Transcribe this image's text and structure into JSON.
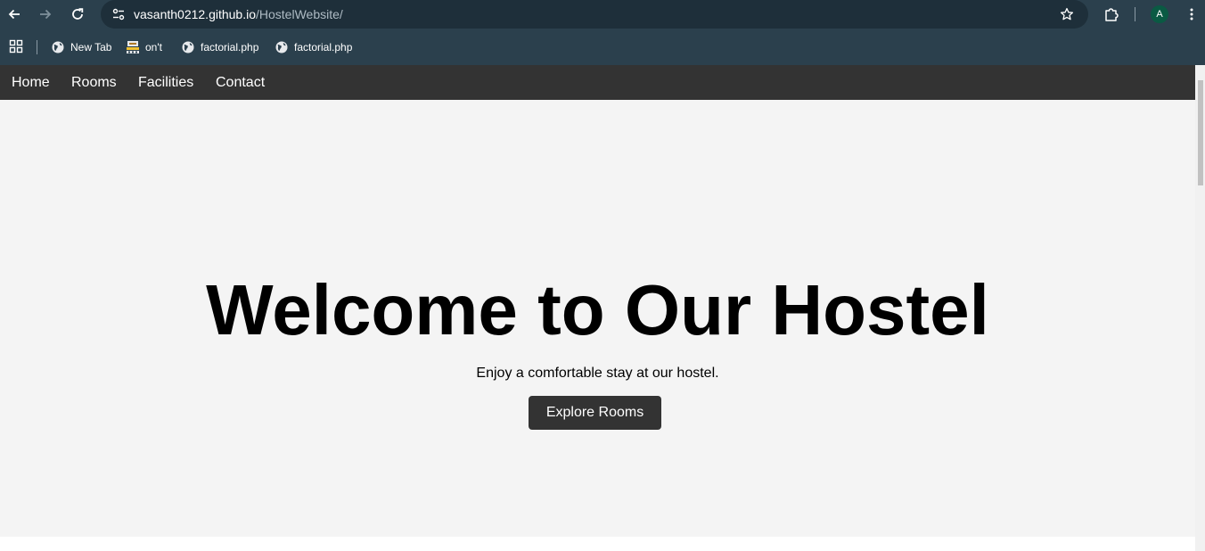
{
  "browser": {
    "url_host": "vasanth0212.github.io",
    "url_path": "/HostelWebsite/",
    "avatar_letter": "A",
    "icons": {
      "back": "arrow-left-icon",
      "forward": "arrow-right-icon",
      "reload": "reload-icon",
      "site_info": "tune-icon",
      "bookmark": "star-icon",
      "extensions": "puzzle-icon",
      "menu": "kebab-menu-icon",
      "apps": "apps-grid-icon"
    },
    "bookmarks": [
      {
        "label": "New Tab",
        "icon": "globe-icon"
      },
      {
        "label": "on't",
        "icon": "site-favicon"
      },
      {
        "label": "factorial.php",
        "icon": "globe-icon"
      },
      {
        "label": "factorial.php",
        "icon": "globe-icon"
      }
    ],
    "colors": {
      "chrome": "#2b404d",
      "omnibox": "#1e2f3a",
      "avatar": "#0a5a43"
    }
  },
  "page": {
    "nav": [
      {
        "label": "Home"
      },
      {
        "label": "Rooms"
      },
      {
        "label": "Facilities"
      },
      {
        "label": "Contact"
      }
    ],
    "hero": {
      "title": "Welcome to Our Hostel",
      "subtitle": "Enjoy a comfortable stay at our hostel.",
      "button": "Explore Rooms"
    },
    "colors": {
      "nav_bg": "#333333",
      "hero_bg": "#f4f4f4",
      "button_bg": "#333333"
    }
  }
}
